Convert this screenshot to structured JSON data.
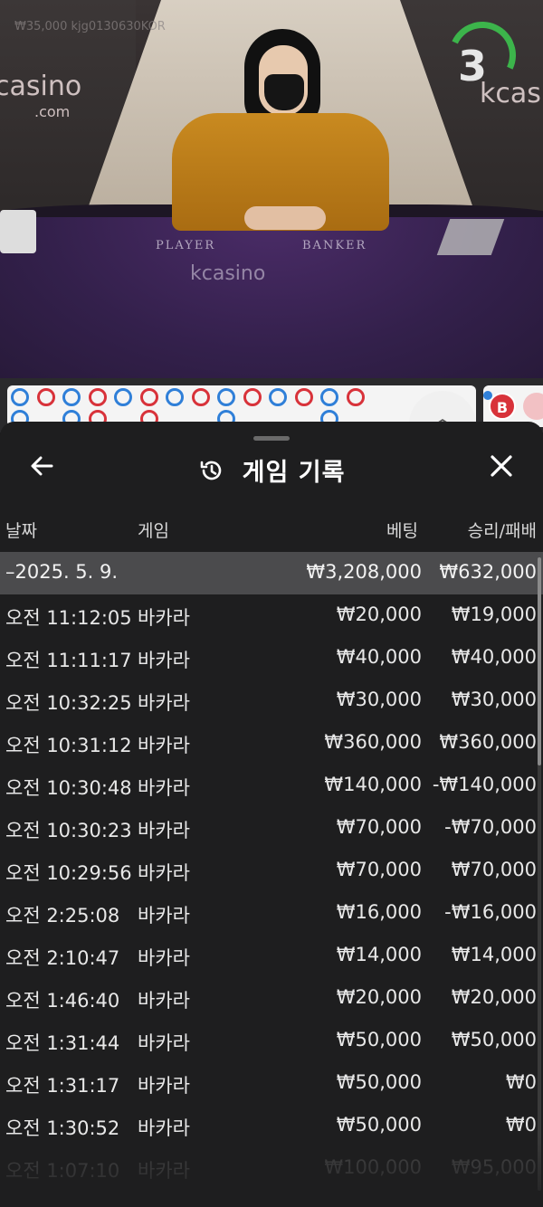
{
  "video": {
    "ghost_text": "₩35,000 kjg0130630KOR",
    "brand_left": "casino",
    "brand_left_sub": ".com",
    "brand_right": "kcas",
    "felt_player": "PLAYER",
    "felt_banker": "BANKER",
    "felt_logo": "kcasino",
    "timer": "3"
  },
  "road": {
    "prediction_b": "B",
    "beads_top": [
      "blue",
      "red",
      "blue",
      "red",
      "blue",
      "red",
      "blue",
      "red",
      "blue",
      "red",
      "blue",
      "red",
      "blue",
      "red"
    ],
    "beads_bottom": [
      "blue",
      "",
      "blue",
      "red",
      "",
      "red",
      "",
      "",
      "blue",
      "",
      "",
      "",
      "blue",
      ""
    ]
  },
  "sheet": {
    "title": "게임 기록",
    "back_icon": "arrow-left-icon",
    "history_icon": "history-clock-icon",
    "close_icon": "close-icon",
    "columns": {
      "date": "날짜",
      "game": "게임",
      "bet": "베팅",
      "result": "승리/패배"
    },
    "date_group": {
      "label": "–2025. 5. 9.",
      "bet": "₩3,208,000",
      "result": "₩632,000"
    },
    "rows": [
      {
        "time": "오전 11:12:05",
        "game": "바카라",
        "bet": "₩20,000",
        "result": "₩19,000"
      },
      {
        "time": "오전 11:11:17",
        "game": "바카라",
        "bet": "₩40,000",
        "result": "₩40,000"
      },
      {
        "time": "오전 10:32:25",
        "game": "바카라",
        "bet": "₩30,000",
        "result": "₩30,000"
      },
      {
        "time": "오전 10:31:12",
        "game": "바카라",
        "bet": "₩360,000",
        "result": "₩360,000"
      },
      {
        "time": "오전 10:30:48",
        "game": "바카라",
        "bet": "₩140,000",
        "result": "-₩140,000"
      },
      {
        "time": "오전 10:30:23",
        "game": "바카라",
        "bet": "₩70,000",
        "result": "-₩70,000"
      },
      {
        "time": "오전 10:29:56",
        "game": "바카라",
        "bet": "₩70,000",
        "result": "₩70,000"
      },
      {
        "time": "오전 2:25:08",
        "game": "바카라",
        "bet": "₩16,000",
        "result": "-₩16,000"
      },
      {
        "time": "오전 2:10:47",
        "game": "바카라",
        "bet": "₩14,000",
        "result": "₩14,000"
      },
      {
        "time": "오전 1:46:40",
        "game": "바카라",
        "bet": "₩20,000",
        "result": "₩20,000"
      },
      {
        "time": "오전 1:31:44",
        "game": "바카라",
        "bet": "₩50,000",
        "result": "₩50,000"
      },
      {
        "time": "오전 1:31:17",
        "game": "바카라",
        "bet": "₩50,000",
        "result": "₩0"
      },
      {
        "time": "오전 1:30:52",
        "game": "바카라",
        "bet": "₩50,000",
        "result": "₩0"
      },
      {
        "time": "오전 1:07:10",
        "game": "바카라",
        "bet": "₩100,000",
        "result": "₩95,000"
      }
    ]
  },
  "colors": {
    "blue": "#2f7fd8",
    "red": "#d8323a",
    "timer": "#3cb44b"
  }
}
